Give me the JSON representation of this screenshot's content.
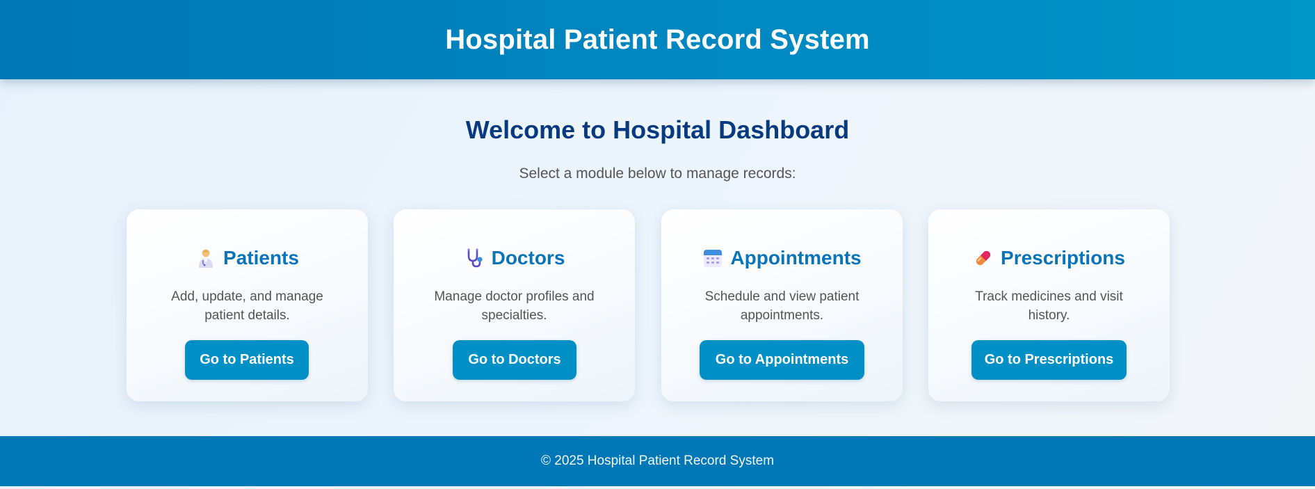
{
  "header": {
    "title": "Hospital Patient Record System"
  },
  "main": {
    "welcome": "Welcome to Hospital Dashboard",
    "subtitle": "Select a module below to manage records:",
    "cards": [
      {
        "icon": "health-worker-icon",
        "title": "Patients",
        "description": "Add, update, and manage patient details.",
        "button": "Go to Patients"
      },
      {
        "icon": "stethoscope-icon",
        "title": "Doctors",
        "description": "Manage doctor profiles and specialties.",
        "button": "Go to Doctors"
      },
      {
        "icon": "calendar-icon",
        "title": "Appointments",
        "description": "Schedule and view patient appointments.",
        "button": "Go to Appointments"
      },
      {
        "icon": "pill-icon",
        "title": "Prescriptions",
        "description": "Track medicines and visit history.",
        "button": "Go to Prescriptions"
      }
    ]
  },
  "footer": {
    "text": "© 2025 Hospital Patient Record System"
  },
  "colors": {
    "header_bg": "#0077b6",
    "heading": "#083a80",
    "card_title": "#0a74b8",
    "button_bg": "#0190c6",
    "footer_bg": "#0077b6"
  }
}
